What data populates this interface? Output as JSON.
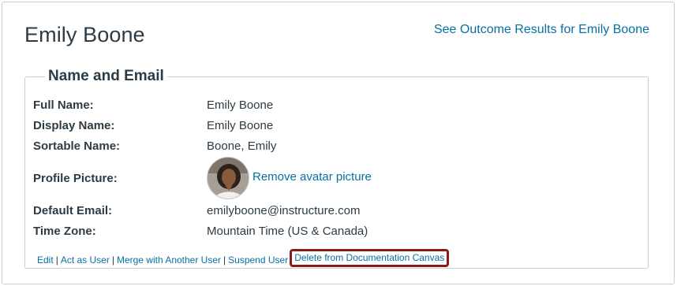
{
  "page": {
    "title": "Emily Boone",
    "outcome_link": "See Outcome Results for Emily Boone"
  },
  "name_email": {
    "legend": "Name and Email",
    "full_name_label": "Full Name:",
    "full_name_value": "Emily Boone",
    "display_name_label": "Display Name:",
    "display_name_value": "Emily Boone",
    "sortable_name_label": "Sortable Name:",
    "sortable_name_value": "Boone, Emily",
    "profile_picture_label": "Profile Picture:",
    "remove_avatar_link": "Remove avatar picture",
    "default_email_label": "Default Email:",
    "default_email_value": "emilyboone@instructure.com",
    "time_zone_label": "Time Zone:",
    "time_zone_value": "Mountain Time (US & Canada)"
  },
  "actions": {
    "edit": "Edit",
    "act_as_user": "Act as User",
    "merge": "Merge with Another User",
    "suspend": "Suspend User",
    "delete": "Delete from Documentation Canvas",
    "separator": "|"
  },
  "colors": {
    "link": "#0770a3",
    "text": "#2d3b45",
    "border": "#c7cdd1",
    "highlight": "#8b1a1a"
  }
}
